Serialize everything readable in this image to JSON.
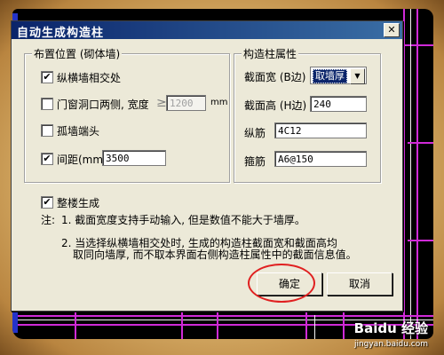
{
  "dialog": {
    "title": "自动生成构造柱",
    "close_glyph": "✕"
  },
  "placement": {
    "group_label": "布置位置 (砌体墙)",
    "wall_intersection": {
      "label": "纵横墙相交处",
      "checked": true
    },
    "door_window": {
      "label": "门窗洞口两侧, 宽度",
      "checked": false,
      "operator": "≥",
      "value": "1200",
      "unit": "mm"
    },
    "isolated_wall_end": {
      "label": "孤墙端头",
      "checked": false
    },
    "spacing": {
      "label": "间距(mm)",
      "checked": true,
      "value": "3500"
    }
  },
  "properties": {
    "group_label": "构造柱属性",
    "section_width": {
      "label": "截面宽 (B边)",
      "value": "取墙厚"
    },
    "section_height": {
      "label": "截面高 (H边)",
      "value": "240"
    },
    "longitudinal_bar": {
      "label": "纵筋",
      "value": "4C12"
    },
    "stirrup": {
      "label": "箍筋",
      "value": "A6@150"
    }
  },
  "whole_floor": {
    "label": "整楼生成",
    "checked": true
  },
  "notes": {
    "prefix": "注:",
    "line1": "1. 截面宽度支持手动输入, 但是数值不能大于墙厚。",
    "line2": "2. 当选择纵横墙相交处时, 生成的构造柱截面宽和截面高均",
    "line3": "取同向墙厚, 而不取本界面右侧构造柱属性中的截面信息值。"
  },
  "buttons": {
    "ok": "确定",
    "cancel": "取消"
  },
  "watermark": {
    "brand": "Baidu 经验",
    "url": "jingyan.baidu.com"
  },
  "check_glyph": "✔",
  "dropdown_glyph": "▼",
  "colors": {
    "title_start": "#0a246a",
    "title_end": "#3a6ea5",
    "dialog_bg": "#ece9d8",
    "highlight_ring": "#e02020",
    "cad_line": "#d02ad8"
  }
}
